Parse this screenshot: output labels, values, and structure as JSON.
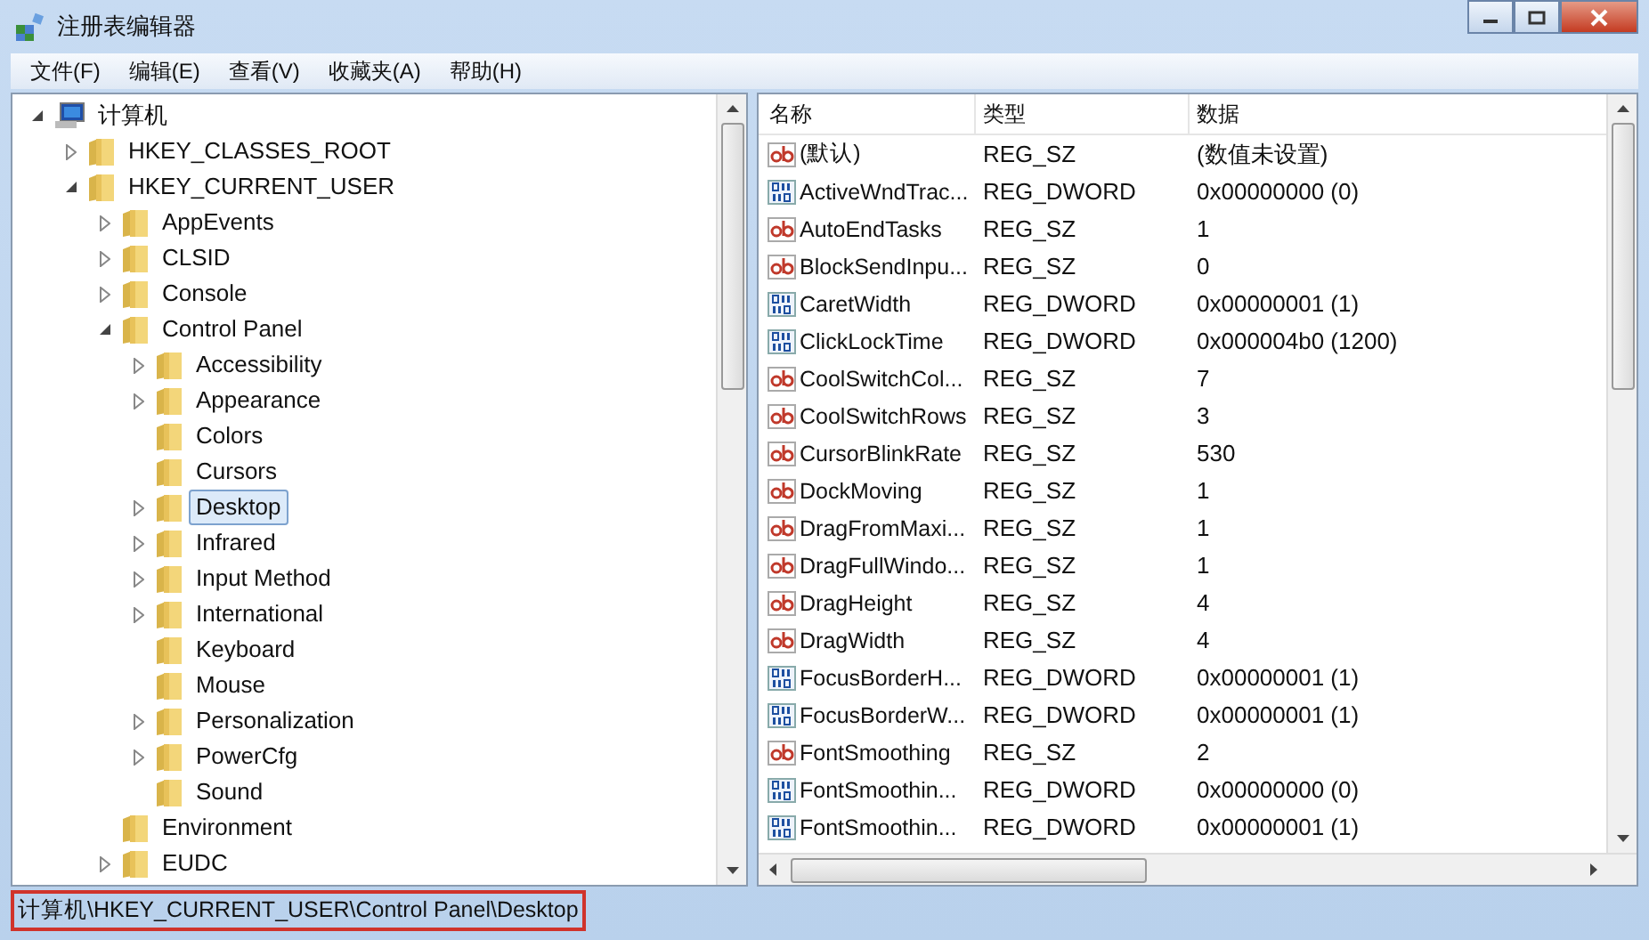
{
  "window": {
    "title": "注册表编辑器"
  },
  "menu": [
    "文件(F)",
    "编辑(E)",
    "查看(V)",
    "收藏夹(A)",
    "帮助(H)"
  ],
  "tree": [
    {
      "label": "计算机",
      "kind": "computer",
      "expanded": true,
      "selected": false,
      "children": [
        {
          "label": "HKEY_CLASSES_ROOT",
          "expanded": false,
          "selected": false
        },
        {
          "label": "HKEY_CURRENT_USER",
          "expanded": true,
          "selected": false,
          "children": [
            {
              "label": "AppEvents",
              "expanded": false,
              "selected": false
            },
            {
              "label": "CLSID",
              "expanded": false,
              "selected": false
            },
            {
              "label": "Console",
              "expanded": false,
              "selected": false
            },
            {
              "label": "Control Panel",
              "expanded": true,
              "selected": false,
              "children": [
                {
                  "label": "Accessibility",
                  "expanded": false,
                  "selected": false
                },
                {
                  "label": "Appearance",
                  "expanded": false,
                  "selected": false
                },
                {
                  "label": "Colors",
                  "selected": false
                },
                {
                  "label": "Cursors",
                  "selected": false
                },
                {
                  "label": "Desktop",
                  "expanded": false,
                  "selected": true
                },
                {
                  "label": "Infrared",
                  "expanded": false,
                  "selected": false
                },
                {
                  "label": "Input Method",
                  "expanded": false,
                  "selected": false
                },
                {
                  "label": "International",
                  "expanded": false,
                  "selected": false
                },
                {
                  "label": "Keyboard",
                  "selected": false
                },
                {
                  "label": "Mouse",
                  "selected": false
                },
                {
                  "label": "Personalization",
                  "expanded": false,
                  "selected": false
                },
                {
                  "label": "PowerCfg",
                  "expanded": false,
                  "selected": false
                },
                {
                  "label": "Sound",
                  "selected": false
                }
              ]
            },
            {
              "label": "Environment",
              "selected": false
            },
            {
              "label": "EUDC",
              "expanded": false,
              "selected": false
            }
          ]
        }
      ]
    }
  ],
  "table": {
    "columns": [
      "名称",
      "类型",
      "数据"
    ],
    "rows": [
      {
        "kind": "string",
        "name": "(默认)",
        "type": "REG_SZ",
        "data": "(数值未设置)"
      },
      {
        "kind": "binary",
        "name": "ActiveWndTrac...",
        "type": "REG_DWORD",
        "data": "0x00000000 (0)"
      },
      {
        "kind": "string",
        "name": "AutoEndTasks",
        "type": "REG_SZ",
        "data": "1"
      },
      {
        "kind": "string",
        "name": "BlockSendInpu...",
        "type": "REG_SZ",
        "data": "0"
      },
      {
        "kind": "binary",
        "name": "CaretWidth",
        "type": "REG_DWORD",
        "data": "0x00000001 (1)"
      },
      {
        "kind": "binary",
        "name": "ClickLockTime",
        "type": "REG_DWORD",
        "data": "0x000004b0 (1200)"
      },
      {
        "kind": "string",
        "name": "CoolSwitchCol...",
        "type": "REG_SZ",
        "data": "7"
      },
      {
        "kind": "string",
        "name": "CoolSwitchRows",
        "type": "REG_SZ",
        "data": "3"
      },
      {
        "kind": "string",
        "name": "CursorBlinkRate",
        "type": "REG_SZ",
        "data": "530"
      },
      {
        "kind": "string",
        "name": "DockMoving",
        "type": "REG_SZ",
        "data": "1"
      },
      {
        "kind": "string",
        "name": "DragFromMaxi...",
        "type": "REG_SZ",
        "data": "1"
      },
      {
        "kind": "string",
        "name": "DragFullWindo...",
        "type": "REG_SZ",
        "data": "1"
      },
      {
        "kind": "string",
        "name": "DragHeight",
        "type": "REG_SZ",
        "data": "4"
      },
      {
        "kind": "string",
        "name": "DragWidth",
        "type": "REG_SZ",
        "data": "4"
      },
      {
        "kind": "binary",
        "name": "FocusBorderH...",
        "type": "REG_DWORD",
        "data": "0x00000001 (1)"
      },
      {
        "kind": "binary",
        "name": "FocusBorderW...",
        "type": "REG_DWORD",
        "data": "0x00000001 (1)"
      },
      {
        "kind": "string",
        "name": "FontSmoothing",
        "type": "REG_SZ",
        "data": "2"
      },
      {
        "kind": "binary",
        "name": "FontSmoothin...",
        "type": "REG_DWORD",
        "data": "0x00000000 (0)"
      },
      {
        "kind": "binary",
        "name": "FontSmoothin...",
        "type": "REG_DWORD",
        "data": "0x00000001 (1)"
      }
    ]
  },
  "status_bar": {
    "path": "计算机\\HKEY_CURRENT_USER\\Control Panel\\Desktop",
    "highlighted": true
  }
}
